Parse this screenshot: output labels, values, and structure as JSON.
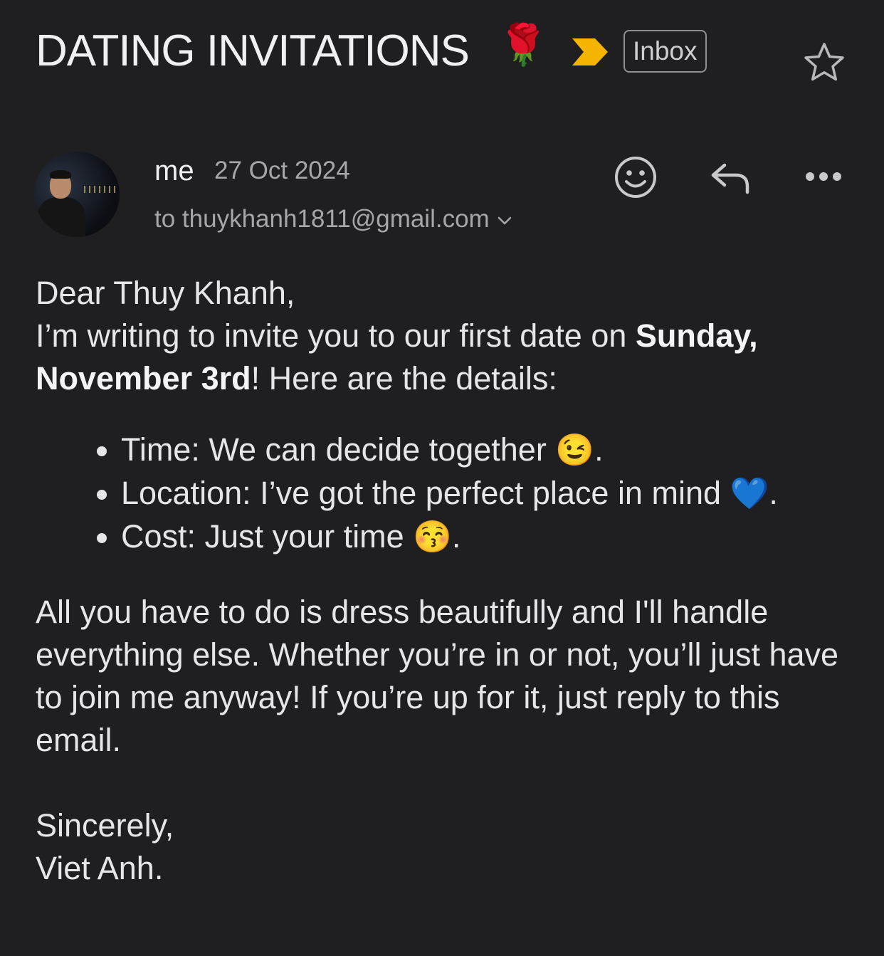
{
  "header": {
    "subject": "DATING INVITATIONS",
    "subject_emoji": "🌹",
    "label": "Inbox",
    "colors": {
      "important_marker": "#f5b400",
      "background": "#1f1f21"
    }
  },
  "message": {
    "sender": "me",
    "date": "27 Oct 2024",
    "recipient": "to thuykhanh1811@gmail.com",
    "body": {
      "greeting": "Dear Thuy Khanh,",
      "intro_before": "I’m writing to invite you to our first date on ",
      "intro_bold": "Sunday, November 3rd",
      "intro_after": "! Here are the details:",
      "details": [
        {
          "text": "Time: We can decide together ",
          "emoji": "😉",
          "end": "."
        },
        {
          "text": "Location: I’ve got the perfect place in mind ",
          "emoji": "💙",
          "end": "."
        },
        {
          "text": "Cost: Just your time ",
          "emoji": "😚",
          "end": "."
        }
      ],
      "paragraph": "All you have to do is dress beautifully and I'll handle everything else. Whether you’re in or not, you’ll just have to join me anyway! If you’re up for it, just reply to this email.",
      "closing": "Sincerely,",
      "signature": "Viet Anh."
    }
  }
}
